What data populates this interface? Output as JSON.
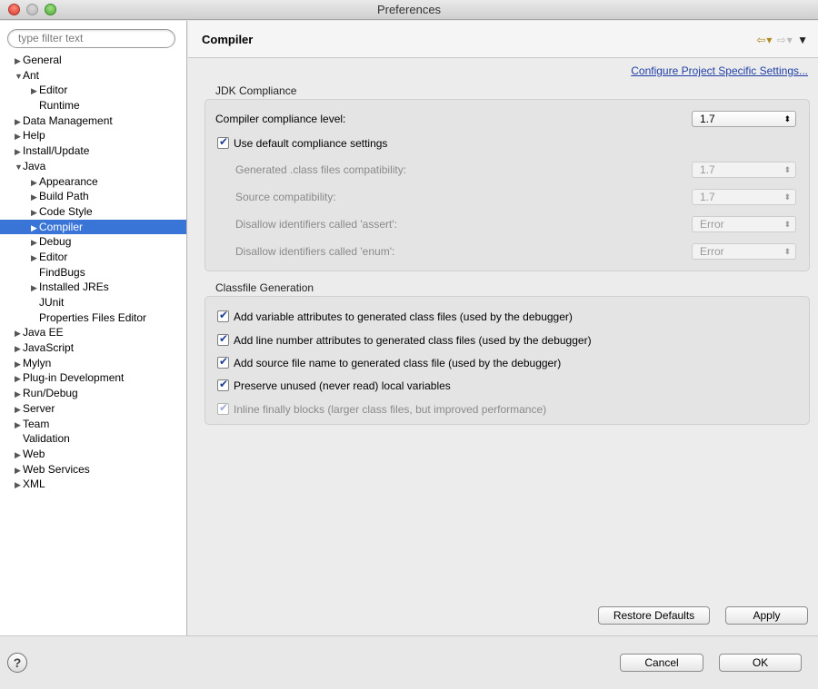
{
  "window": {
    "title": "Preferences"
  },
  "filter": {
    "placeholder": "type filter text"
  },
  "tree": [
    {
      "label": "General",
      "depth": 0,
      "arrow": "▶"
    },
    {
      "label": "Ant",
      "depth": 0,
      "arrow": "▼"
    },
    {
      "label": "Editor",
      "depth": 1,
      "arrow": "▶"
    },
    {
      "label": "Runtime",
      "depth": 1,
      "arrow": ""
    },
    {
      "label": "Data Management",
      "depth": 0,
      "arrow": "▶"
    },
    {
      "label": "Help",
      "depth": 0,
      "arrow": "▶"
    },
    {
      "label": "Install/Update",
      "depth": 0,
      "arrow": "▶"
    },
    {
      "label": "Java",
      "depth": 0,
      "arrow": "▼"
    },
    {
      "label": "Appearance",
      "depth": 1,
      "arrow": "▶"
    },
    {
      "label": "Build Path",
      "depth": 1,
      "arrow": "▶"
    },
    {
      "label": "Code Style",
      "depth": 1,
      "arrow": "▶"
    },
    {
      "label": "Compiler",
      "depth": 1,
      "arrow": "▶",
      "selected": true
    },
    {
      "label": "Debug",
      "depth": 1,
      "arrow": "▶"
    },
    {
      "label": "Editor",
      "depth": 1,
      "arrow": "▶"
    },
    {
      "label": "FindBugs",
      "depth": 1,
      "arrow": ""
    },
    {
      "label": "Installed JREs",
      "depth": 1,
      "arrow": "▶"
    },
    {
      "label": "JUnit",
      "depth": 1,
      "arrow": ""
    },
    {
      "label": "Properties Files Editor",
      "depth": 1,
      "arrow": ""
    },
    {
      "label": "Java EE",
      "depth": 0,
      "arrow": "▶"
    },
    {
      "label": "JavaScript",
      "depth": 0,
      "arrow": "▶"
    },
    {
      "label": "Mylyn",
      "depth": 0,
      "arrow": "▶"
    },
    {
      "label": "Plug-in Development",
      "depth": 0,
      "arrow": "▶"
    },
    {
      "label": "Run/Debug",
      "depth": 0,
      "arrow": "▶"
    },
    {
      "label": "Server",
      "depth": 0,
      "arrow": "▶"
    },
    {
      "label": "Team",
      "depth": 0,
      "arrow": "▶"
    },
    {
      "label": "Validation",
      "depth": 0,
      "arrow": ""
    },
    {
      "label": "Web",
      "depth": 0,
      "arrow": "▶"
    },
    {
      "label": "Web Services",
      "depth": 0,
      "arrow": "▶"
    },
    {
      "label": "XML",
      "depth": 0,
      "arrow": "▶"
    }
  ],
  "page": {
    "title": "Compiler",
    "config_link": "Configure Project Specific Settings...",
    "jdk": {
      "group_label": "JDK Compliance",
      "compliance_label": "Compiler compliance level:",
      "compliance_value": "1.7",
      "use_default_label": "Use default compliance settings",
      "generated_label": "Generated .class files compatibility:",
      "generated_value": "1.7",
      "source_label": "Source compatibility:",
      "source_value": "1.7",
      "assert_label": "Disallow identifiers called 'assert':",
      "assert_value": "Error",
      "enum_label": "Disallow identifiers called 'enum':",
      "enum_value": "Error"
    },
    "classfile": {
      "group_label": "Classfile Generation",
      "opt1": "Add variable attributes to generated class files (used by the debugger)",
      "opt2": "Add line number attributes to generated class files (used by the debugger)",
      "opt3": "Add source file name to generated class file (used by the debugger)",
      "opt4": "Preserve unused (never read) local variables",
      "opt5": "Inline finally blocks (larger class files, but improved performance)"
    },
    "restore_label": "Restore Defaults",
    "apply_label": "Apply"
  },
  "footer": {
    "help_glyph": "?",
    "cancel_label": "Cancel",
    "ok_label": "OK"
  },
  "colors": {
    "selection": "#3875d7",
    "link": "#1f3fa6"
  }
}
